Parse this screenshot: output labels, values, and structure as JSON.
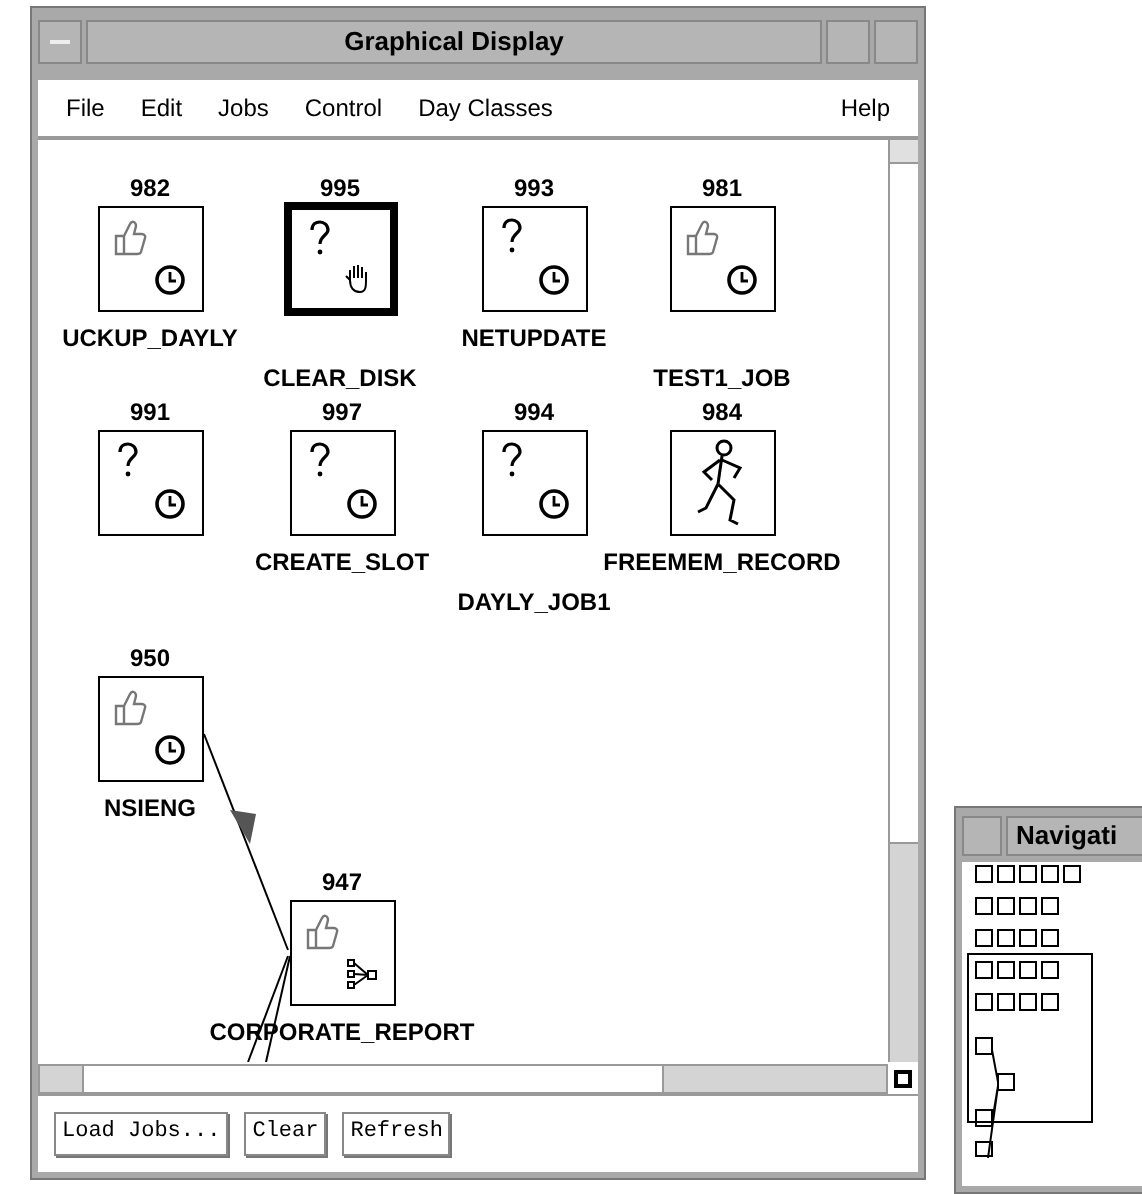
{
  "window": {
    "title": "Graphical Display"
  },
  "menu": [
    "File",
    "Edit",
    "Jobs",
    "Control",
    "Day Classes"
  ],
  "help_menu": "Help",
  "jobs": [
    {
      "number": "982",
      "name": "UCKUP_DAYLY",
      "icons": [
        {
          "kind": "thumb"
        },
        {
          "kind": "clock"
        }
      ],
      "selected": false
    },
    {
      "number": "995",
      "name": "CLEAR_DISK",
      "icons": [
        {
          "kind": "question"
        },
        {
          "kind": "hand"
        }
      ],
      "selected": true
    },
    {
      "number": "993",
      "name": "NETUPDATE",
      "icons": [
        {
          "kind": "question"
        },
        {
          "kind": "clock"
        }
      ],
      "selected": false
    },
    {
      "number": "981",
      "name": "TEST1_JOB",
      "icons": [
        {
          "kind": "thumb"
        },
        {
          "kind": "clock"
        }
      ],
      "selected": false
    },
    {
      "number": "991",
      "icons": [
        {
          "kind": "question"
        },
        {
          "kind": "clock"
        }
      ],
      "selected": false
    },
    {
      "number": "997",
      "name": "CREATE_SLOT",
      "icons": [
        {
          "kind": "question"
        },
        {
          "kind": "clock"
        }
      ],
      "selected": false
    },
    {
      "number": "994",
      "name": "DAYLY_JOB1",
      "icons": [
        {
          "kind": "question"
        },
        {
          "kind": "clock"
        }
      ],
      "selected": false
    },
    {
      "number": "984",
      "name": "FREEMEM_RECORD",
      "icons": [
        {
          "kind": "runner"
        }
      ],
      "selected": false
    },
    {
      "number": "950",
      "name": "NSIENG",
      "icons": [
        {
          "kind": "thumb"
        },
        {
          "kind": "clock"
        }
      ],
      "selected": false
    },
    {
      "number": "947",
      "name": "CORPORATE_REPORT",
      "icons": [
        {
          "kind": "thumb"
        },
        {
          "kind": "fork"
        }
      ],
      "selected": false
    }
  ],
  "buttons": [
    "Load Jobs...",
    "Clear",
    "Refresh"
  ],
  "navigator": {
    "title": "Navigati"
  }
}
